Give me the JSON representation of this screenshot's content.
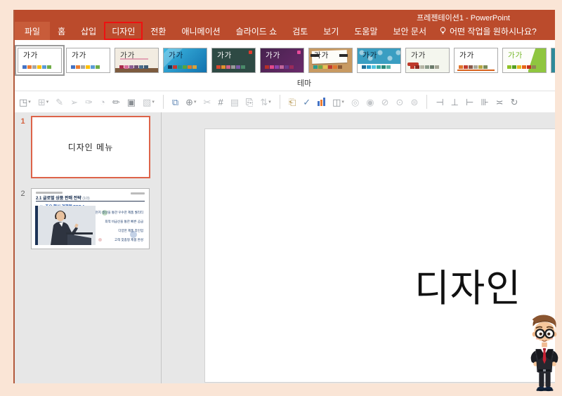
{
  "window": {
    "title": "프레젠테이션1  -  PowerPoint"
  },
  "tabs": {
    "items": [
      "파일",
      "홈",
      "삽입",
      "디자인",
      "전환",
      "애니메이션",
      "슬라이드 쇼",
      "검토",
      "보기",
      "도움말",
      "보안 문서"
    ],
    "active": "디자인",
    "tell_me": "어떤 작업을 원하시나요?"
  },
  "colors": {
    "titlebar": "#bb4b2c",
    "file_tab": "#c85c3a",
    "page_background": "#fae5d6",
    "highlight_box": "#ee1111",
    "selected_slide_border": "#dd6349"
  },
  "ribbon": {
    "group_label": "테마",
    "theme_sample_text": "가가",
    "themes": [
      {
        "name": "theme-office-white-1",
        "selected": true,
        "bg": "#ffffff",
        "text": "#222222",
        "deco": "none",
        "swatches": [
          "#4472c4",
          "#ed7d31",
          "#a5a5a5",
          "#ffc000",
          "#5b9bd5",
          "#70ad47"
        ]
      },
      {
        "name": "theme-office-white-2",
        "selected": false,
        "bg": "#ffffff",
        "text": "#222222",
        "deco": "none",
        "swatches": [
          "#4472c4",
          "#ed7d31",
          "#a5a5a5",
          "#ffc000",
          "#5b9bd5",
          "#70ad47"
        ]
      },
      {
        "name": "theme-gallery-paper",
        "selected": false,
        "bg": "#f2ece1",
        "text": "#3a3a3a",
        "deco": "underline-bottombar",
        "deco_colors": [
          "#e3a3b4",
          "#7d5b3e"
        ],
        "swatches": [
          "#ab2b4a",
          "#d86f9c",
          "#8e5f94",
          "#6b4e71",
          "#4a6d8c",
          "#3e5a74"
        ]
      },
      {
        "name": "theme-slice-blue",
        "selected": false,
        "bg": "linear-gradient(135deg,#3cb8e2,#1272ae)",
        "text": "#0b2948",
        "deco": "diag",
        "swatches": [
          "#153a5e",
          "#c6372e",
          "#1f9a8a",
          "#57a639",
          "#e07b28",
          "#d8a13a"
        ]
      },
      {
        "name": "theme-dark-teal",
        "selected": false,
        "bg": "#2e4a44",
        "text": "#ffffff",
        "deco": "dot-tr",
        "deco_colors": [
          "#e23b2e"
        ],
        "swatches": [
          "#d9472e",
          "#e2902e",
          "#d0608a",
          "#9a9a9a",
          "#7a5ba6",
          "#4a8a6a"
        ]
      },
      {
        "name": "theme-ion-purple",
        "selected": false,
        "bg": "linear-gradient(135deg,#46224e,#6a2a6a)",
        "text": "#ffffff",
        "deco": "dot-tr",
        "deco_colors": [
          "#e84a9a"
        ],
        "swatches": [
          "#b5302a",
          "#e2498a",
          "#8e44ad",
          "#c0659a",
          "#6a3a8a",
          "#9a2a5a"
        ]
      },
      {
        "name": "theme-wood-type",
        "selected": false,
        "bg": "#c89a62",
        "text": "#222222",
        "deco": "paper-tape",
        "swatches": [
          "#2a9d8f",
          "#70a845",
          "#e3c353",
          "#c23b2e",
          "#e0762e",
          "#8a5a36"
        ]
      },
      {
        "name": "theme-integral-pattern",
        "selected": false,
        "bg": "#3a9ec2",
        "text": "#10283a",
        "deco": "pattern-whitestrip",
        "swatches": [
          "#1f6f9a",
          "#2a9dc9",
          "#4ec3e0",
          "#35a8a0",
          "#2a8a7a",
          "#5ab5a5"
        ]
      },
      {
        "name": "theme-light-brush",
        "selected": false,
        "bg": "#f4f6ee",
        "text": "#333333",
        "deco": "brush",
        "deco_colors": [
          "#bf3a2b"
        ],
        "swatches": [
          "#bf3a2b",
          "#8a2a20",
          "#b5b5a5",
          "#8a9a8a",
          "#6a7a6a",
          "#a5a595"
        ]
      },
      {
        "name": "theme-white-orange",
        "selected": false,
        "bg": "#ffffff",
        "text": "#222222",
        "deco": "orangeline",
        "deco_colors": [
          "#d86018"
        ],
        "swatches": [
          "#e0762e",
          "#c23b2e",
          "#8a5a4a",
          "#aaa89a",
          "#b5a642",
          "#7a8a5a"
        ]
      },
      {
        "name": "theme-facet-green",
        "selected": false,
        "bg": "#fdfdfa",
        "text": "#76b729",
        "deco": "chevron",
        "deco_colors": [
          "#8fc63f",
          "#5a8a1e"
        ],
        "swatches": [
          "#90c226",
          "#54a021",
          "#e6b91e",
          "#e76618",
          "#c42f1a",
          "#918655"
        ]
      },
      {
        "name": "theme-teal-partial",
        "selected": false,
        "bg": "#2e8a9a",
        "text": "#ffffff",
        "deco": "none",
        "swatches": [
          "#1f6f7a",
          "#2a9aaa",
          "#4ebfcf",
          "#35a8a0",
          "#2a8a7a",
          "#5ab5a5"
        ]
      }
    ]
  },
  "toolbar": {
    "icons": [
      {
        "name": "shape-select-icon",
        "glyph": "◳",
        "caret": true,
        "tone": "normal"
      },
      {
        "name": "marquee-select-icon",
        "glyph": "⊞",
        "caret": true,
        "tone": "faint"
      },
      {
        "name": "highlighter-icon",
        "glyph": "✎",
        "caret": false,
        "tone": "faint"
      },
      {
        "name": "pointer-arrow-icon",
        "glyph": "➢",
        "caret": false,
        "tone": "faint"
      },
      {
        "name": "brush-icon",
        "glyph": "✑",
        "caret": false,
        "tone": "faint"
      },
      {
        "name": "pie-chart-icon",
        "glyph": "◔",
        "caret": false,
        "tone": "faint"
      },
      {
        "name": "pencil-icon",
        "glyph": "✏",
        "caret": false,
        "tone": "normal"
      },
      {
        "name": "picture-frame-icon",
        "glyph": "▣",
        "caret": false,
        "tone": "normal"
      },
      {
        "name": "shape-style-icon",
        "glyph": "▧",
        "caret": true,
        "tone": "faint"
      },
      {
        "name": "separator",
        "glyph": "",
        "caret": false,
        "tone": "sep"
      },
      {
        "name": "slide-monitor-icon",
        "glyph": "⧉",
        "caret": false,
        "tone": "blue"
      },
      {
        "name": "camera-add-icon",
        "glyph": "⊕",
        "caret": true,
        "tone": "normal"
      },
      {
        "name": "crop-percent-icon",
        "glyph": "✂",
        "caret": false,
        "tone": "faint"
      },
      {
        "name": "crop-hash-icon",
        "glyph": "#",
        "caret": false,
        "tone": "normal"
      },
      {
        "name": "picture-icon",
        "glyph": "▤",
        "caret": false,
        "tone": "faint"
      },
      {
        "name": "duplicate-icon",
        "glyph": "⎘",
        "caret": false,
        "tone": "normal"
      },
      {
        "name": "tilt-text-icon",
        "glyph": "⇅",
        "caret": true,
        "tone": "faint"
      },
      {
        "name": "separator",
        "glyph": "",
        "caret": false,
        "tone": "sep"
      },
      {
        "name": "clipboard-paste-icon",
        "glyph": "⎗",
        "caret": false,
        "tone": "tan"
      },
      {
        "name": "approve-icon",
        "glyph": "✓",
        "caret": false,
        "tone": "blue"
      },
      {
        "name": "column-chart-icon",
        "glyph": "",
        "caret": false,
        "tone": "chart"
      },
      {
        "name": "table-draw-icon",
        "glyph": "◫",
        "caret": true,
        "tone": "normal"
      },
      {
        "name": "merge-union-icon",
        "glyph": "◎",
        "caret": false,
        "tone": "faint"
      },
      {
        "name": "merge-combine-icon",
        "glyph": "◉",
        "caret": false,
        "tone": "faint"
      },
      {
        "name": "merge-fragment-icon",
        "glyph": "⊘",
        "caret": false,
        "tone": "faint"
      },
      {
        "name": "merge-intersect-icon",
        "glyph": "⊙",
        "caret": false,
        "tone": "faint"
      },
      {
        "name": "merge-subtract-icon",
        "glyph": "⊜",
        "caret": false,
        "tone": "faint"
      },
      {
        "name": "separator",
        "glyph": "",
        "caret": false,
        "tone": "sep"
      },
      {
        "name": "align-left-icon",
        "glyph": "⊣",
        "caret": false,
        "tone": "normal"
      },
      {
        "name": "align-bottom-icon",
        "glyph": "⊥",
        "caret": false,
        "tone": "normal"
      },
      {
        "name": "align-right-icon",
        "glyph": "⊢",
        "caret": false,
        "tone": "normal"
      },
      {
        "name": "distribute-icon",
        "glyph": "⊪",
        "caret": false,
        "tone": "normal"
      },
      {
        "name": "align-middle-icon",
        "glyph": "≍",
        "caret": false,
        "tone": "normal"
      },
      {
        "name": "rotate-icon",
        "glyph": "↻",
        "caret": false,
        "tone": "normal"
      }
    ],
    "chart_icon_bar_colors": [
      "#4472c4",
      "#ed7d31",
      "#4472c4"
    ]
  },
  "slide_panel": {
    "slide1": {
      "number": "1",
      "title": "디자인 메뉴",
      "selected": true
    },
    "slide2": {
      "number": "2",
      "header_title": "2.1 글로벌 상품 판매 전략",
      "header_suffix": "(1/3)",
      "subtitle": "≫ 주요 핵심 경쟁력 TOP 4",
      "bullets": [
        "현지 생산을 통한 우수한 제품 퀄리티",
        "최적 비급선을 통한 빠른 공급",
        "다양한 제품 라인업",
        "고객 맞춤형 제품 완성"
      ]
    }
  },
  "canvas": {
    "slide_title": "디자인"
  }
}
